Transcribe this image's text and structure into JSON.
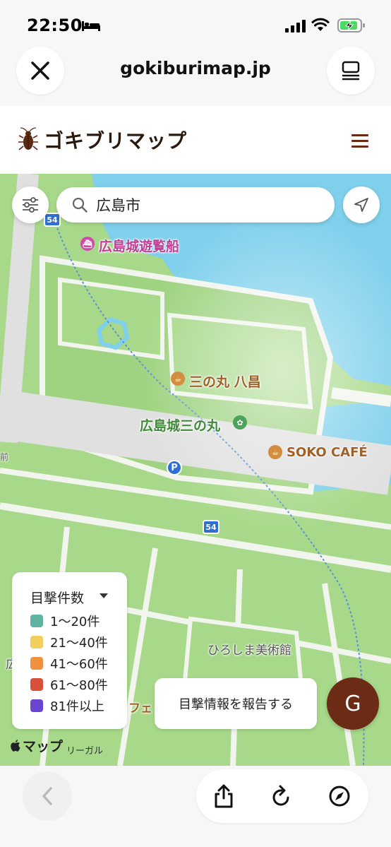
{
  "status_bar": {
    "time": "22:50"
  },
  "browser": {
    "url": "gokiburimap.jp"
  },
  "site": {
    "title": "ゴキブリマップ"
  },
  "search": {
    "value": "広島市"
  },
  "map": {
    "labels": {
      "boat": "広島城遊覧船",
      "sannomaru_yakichi": "三の丸 八昌",
      "hiroshima_sannomaru": "広島城三の丸",
      "soko_cafe": "SOKO CAFÉ",
      "museum": "ひろしま美術館",
      "route_top": "54",
      "route_mid": "54",
      "parking": "P",
      "edge_left_1": "前",
      "edge_left_2": "広",
      "cafe_partial": "フェ"
    }
  },
  "legend": {
    "title": "目撃件数",
    "items": [
      {
        "label": "1〜20件",
        "color": "#5fb3a3"
      },
      {
        "label": "21〜40件",
        "color": "#f2cf5b"
      },
      {
        "label": "41〜60件",
        "color": "#f0923d"
      },
      {
        "label": "61〜80件",
        "color": "#d9503a"
      },
      {
        "label": "81件以上",
        "color": "#6a45d1"
      }
    ]
  },
  "actions": {
    "report_label": "目撃情報を報告する",
    "avatar_initial": "G"
  },
  "attribution": {
    "maps": "マップ",
    "legal": "リーガル"
  },
  "colors": {
    "brand": "#6b2b14",
    "water": "#7fd0ec",
    "park": "#a8d98a",
    "road": "#e9e9e9"
  }
}
